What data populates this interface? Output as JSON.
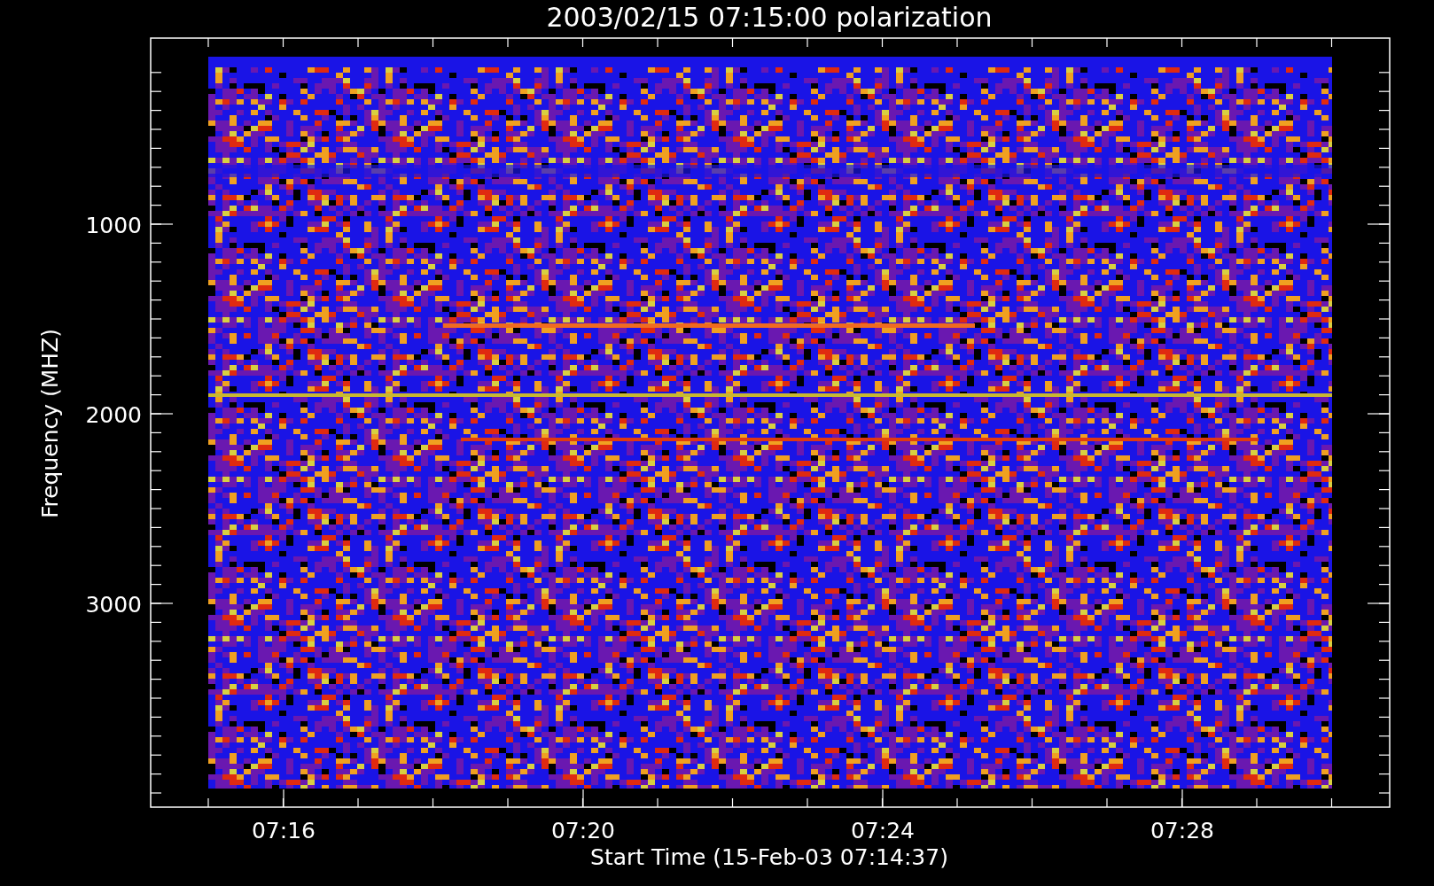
{
  "title": "2003/02/15 07:15:00 polarization",
  "y_axis": {
    "label": "Frequency (MHZ)",
    "ticks": [
      "1000",
      "2000",
      "3000"
    ]
  },
  "x_axis": {
    "label": "Start Time (15-Feb-03 07:14:37)",
    "ticks": [
      "07:16",
      "07:20",
      "07:24",
      "07:28"
    ]
  }
}
